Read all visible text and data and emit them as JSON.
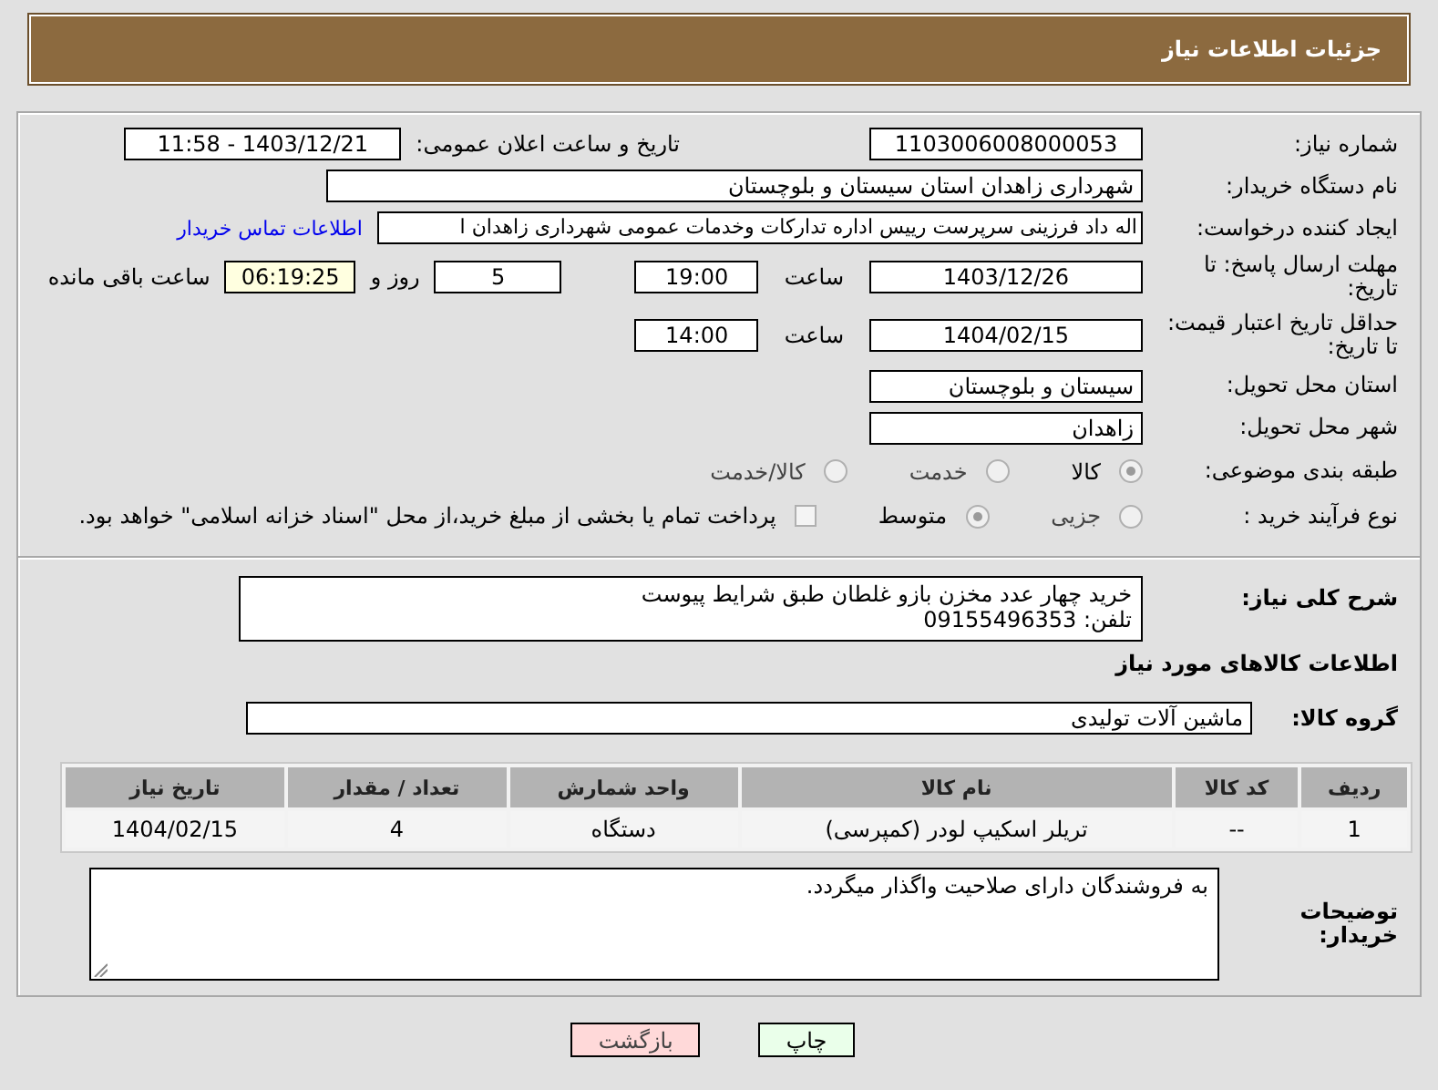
{
  "header": {
    "title": "جزئیات اطلاعات نیاز"
  },
  "need_number": {
    "label": "شماره نیاز:",
    "value": "1103006008000053"
  },
  "announce": {
    "label": "تاریخ و ساعت اعلان عمومی:",
    "value": "1403/12/21 - 11:58"
  },
  "buyer_org": {
    "label": "نام دستگاه خریدار:",
    "value": "شهرداری زاهدان استان سیستان و بلوچستان"
  },
  "requester": {
    "label": "ایجاد کننده درخواست:",
    "value": "اله داد فرزینی سرپرست رییس اداره تدارکات وخدمات عمومی شهرداری زاهدان ا",
    "link": "اطلاعات تماس خریدار"
  },
  "deadline": {
    "label": "مهلت ارسال پاسخ: تا تاریخ:",
    "date": "1403/12/26",
    "time_label": "ساعت",
    "time": "19:00",
    "days": "5",
    "days_label": "روز و",
    "remaining": "06:19:25",
    "remaining_label": "ساعت باقی مانده"
  },
  "validity": {
    "label": "حداقل تاریخ اعتبار قیمت: تا تاریخ:",
    "date": "1404/02/15",
    "time_label": "ساعت",
    "time": "14:00"
  },
  "province": {
    "label": "استان محل تحویل:",
    "value": "سیستان و بلوچستان"
  },
  "city": {
    "label": "شهر محل تحویل:",
    "value": "زاهدان"
  },
  "category": {
    "label": "طبقه بندی موضوعی:",
    "options": [
      {
        "label": "کالا",
        "selected": true
      },
      {
        "label": "خدمت",
        "selected": false
      },
      {
        "label": "کالا/خدمت",
        "selected": false
      }
    ]
  },
  "process": {
    "label": "نوع فرآیند خرید :",
    "options": [
      {
        "label": "جزیی",
        "selected": false
      },
      {
        "label": "متوسط",
        "selected": true
      }
    ],
    "treasury": {
      "label": "پرداخت تمام یا بخشی از مبلغ خرید،از محل \"اسناد خزانه اسلامی\" خواهد بود.",
      "checked": false
    }
  },
  "description": {
    "label": "شرح کلی نیاز:",
    "lines": [
      "خرید چهار عدد مخزن بازو غلطان طبق شرایط پیوست",
      "تلفن: 09155496353"
    ]
  },
  "goods": {
    "heading": "اطلاعات کالاهای مورد نیاز",
    "group": {
      "label": "گروه کالا:",
      "value": "ماشین آلات تولیدی"
    },
    "columns": [
      "ردیف",
      "کد کالا",
      "نام کالا",
      "واحد شمارش",
      "تعداد / مقدار",
      "تاریخ نیاز"
    ],
    "rows": [
      [
        "1",
        "--",
        "تریلر اسکیپ لودر (کمپرسی)",
        "دستگاه",
        "4",
        "1404/02/15"
      ]
    ]
  },
  "notes": {
    "label": "توضیحات خریدار:",
    "value": "به فروشندگان دارای صلاحیت واگذار میگردد."
  },
  "buttons": [
    {
      "label": "چاپ",
      "kind": "print"
    },
    {
      "label": "بازگشت",
      "kind": "back"
    }
  ]
}
